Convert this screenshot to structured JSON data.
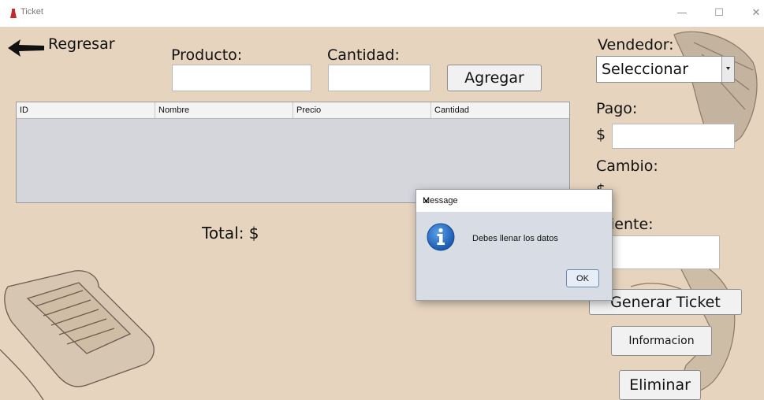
{
  "window": {
    "title": "Ticket",
    "minimize_glyph": "—",
    "maximize_glyph": "☐",
    "close_glyph": "✕"
  },
  "header": {
    "back_label": "Regresar",
    "producto_label": "Producto:",
    "producto_value": "",
    "cantidad_label": "Cantidad:",
    "cantidad_value": "",
    "add_button": "Agregar"
  },
  "table": {
    "columns": [
      "ID",
      "Nombre",
      "Precio",
      "Cantidad"
    ],
    "rows": []
  },
  "total": {
    "label": "Total: $"
  },
  "right_panel": {
    "vendedor_label": "Vendedor:",
    "vendedor_selected": "Seleccionar",
    "pago_label": "Pago:",
    "currency_symbol": "$",
    "pago_value": "",
    "cambio_label": "Cambio:",
    "cambio_value_partial": "$",
    "cliente_label_partial": "iente:",
    "cliente_value": "",
    "generate_button": "Generar Ticket",
    "info_button": "Informacion",
    "delete_button": "Eliminar"
  },
  "dialog": {
    "title": "Message",
    "message": "Debes llenar los datos",
    "ok_button": "OK",
    "icon": "info-icon"
  },
  "colors": {
    "background": "#e6d4be",
    "table_body": "#d4d6dc",
    "dialog_body": "#d8dde5",
    "info_icon": "#1f6bc4"
  }
}
